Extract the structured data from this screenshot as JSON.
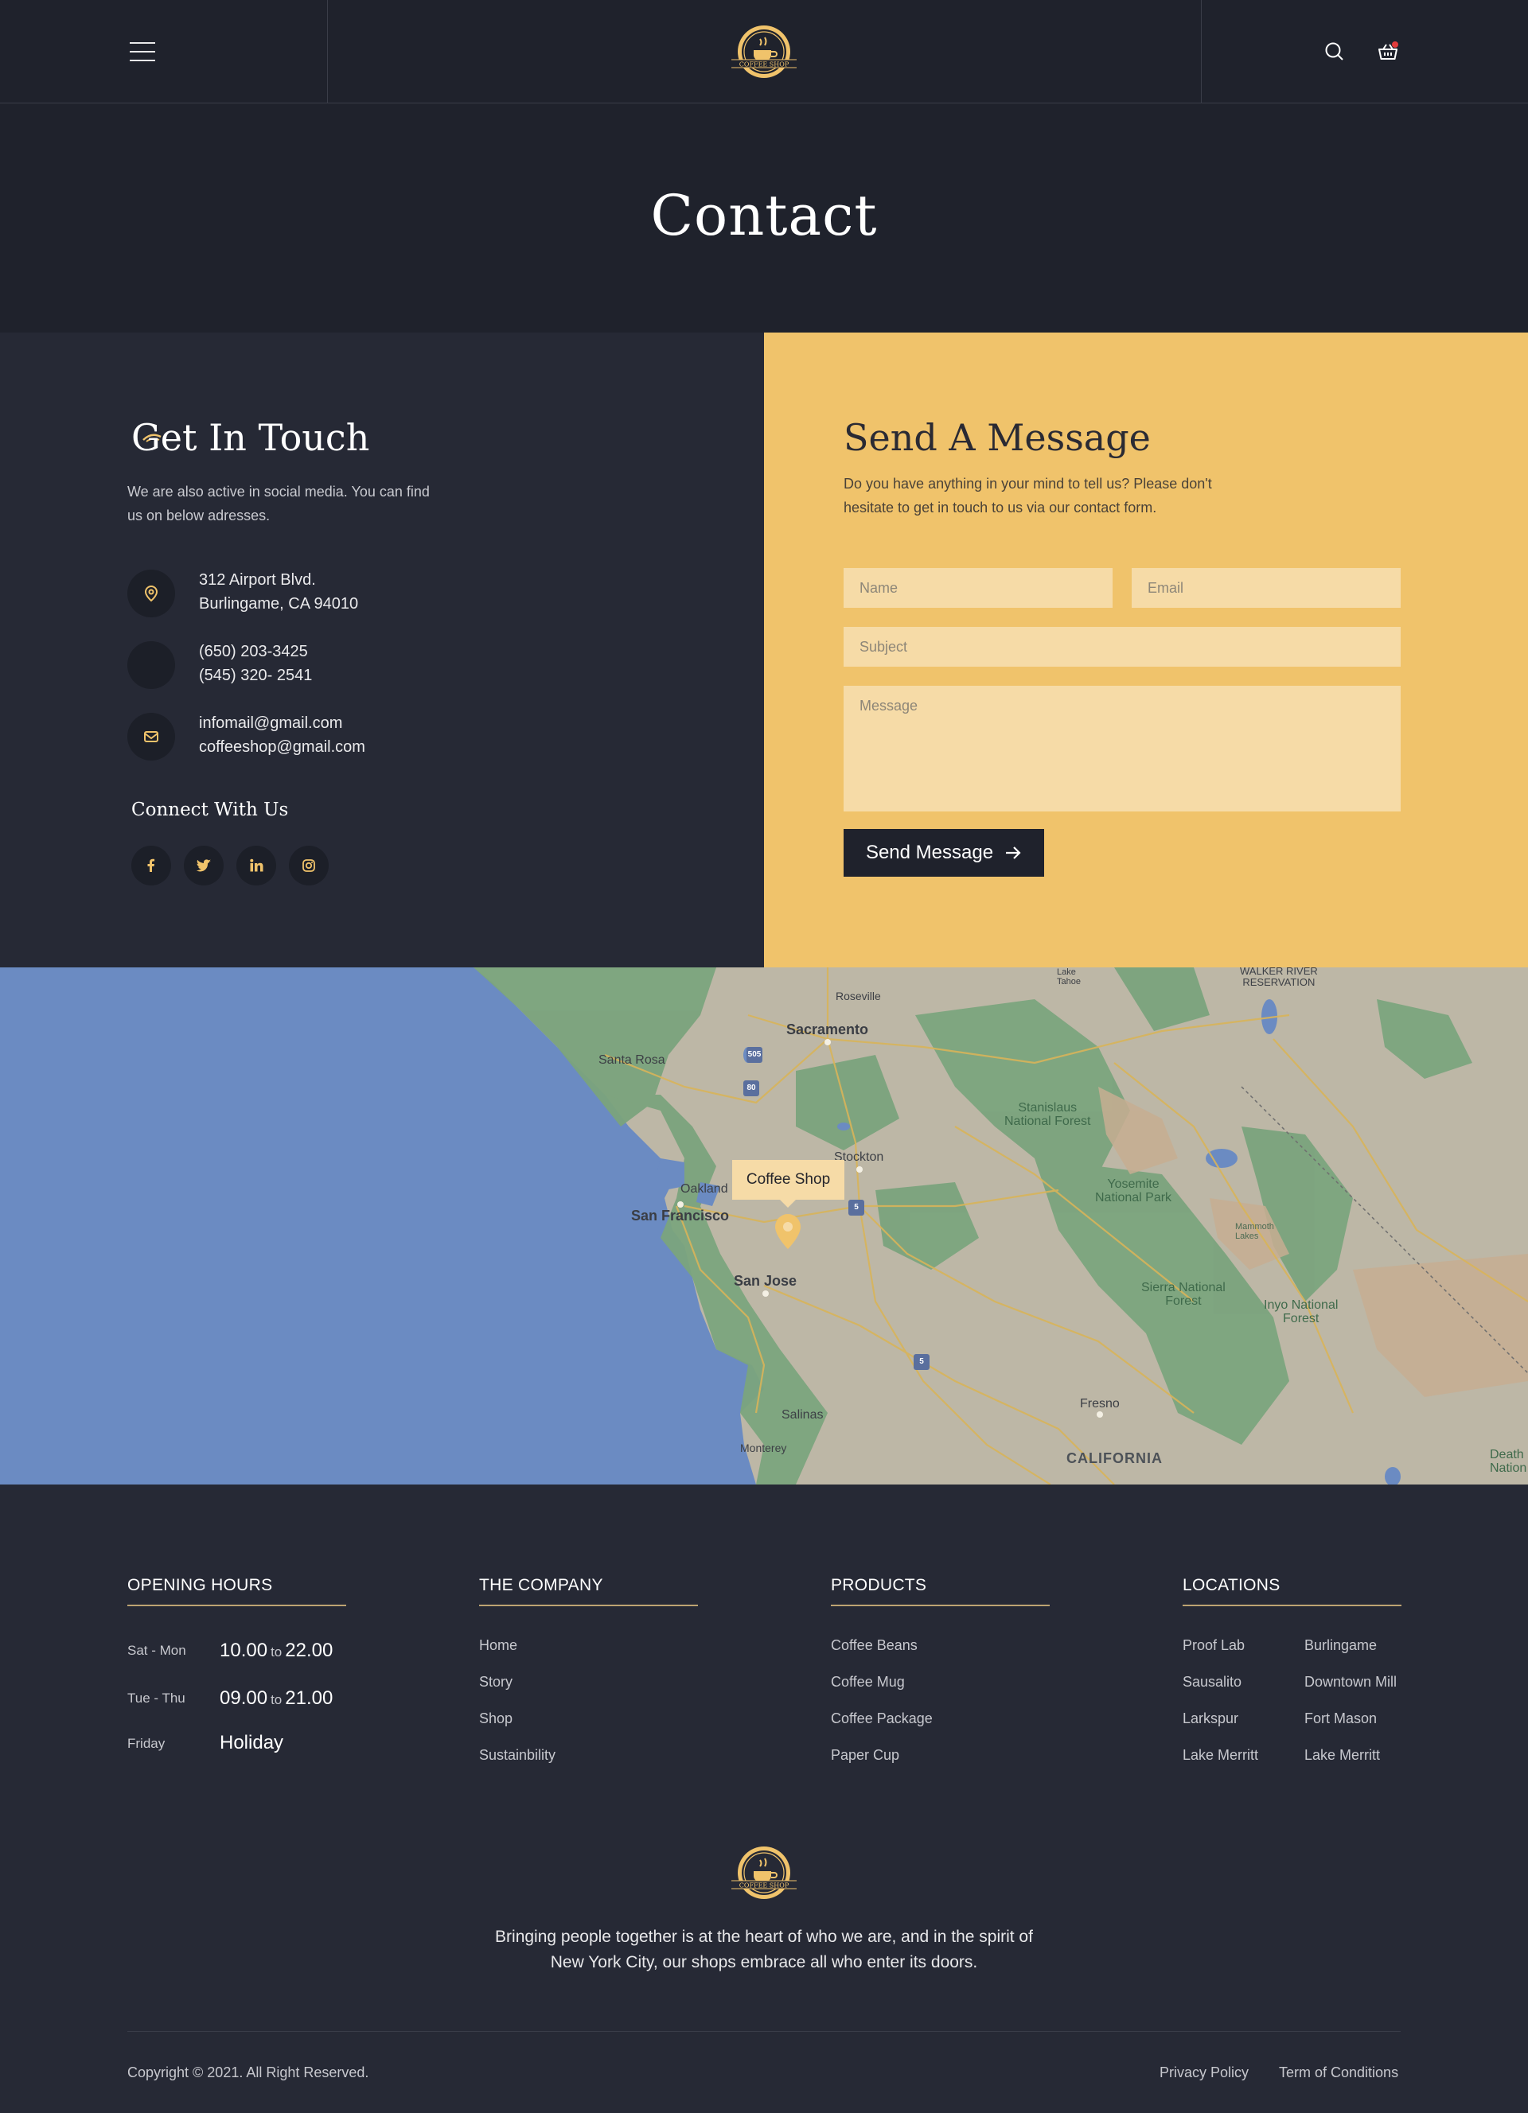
{
  "header": {
    "logo_text": "COFFEE SHOP",
    "menu_icon": "hamburger-menu-icon",
    "search_icon": "search-icon",
    "cart_icon": "basket-icon"
  },
  "hero": {
    "title": "Contact"
  },
  "get_in_touch": {
    "title": "Get In Touch",
    "text": "We are also active in social media. You can find us on below adresses.",
    "address_line1": "312 Airport Blvd.",
    "address_line2": "Burlingame, CA 94010",
    "phone1": "(650) 203-3425",
    "phone2": "(545) 320- 2541",
    "email1": "infomail@gmail.com",
    "email2": "coffeeshop@gmail.com",
    "connect_title": "Connect With Us",
    "social": [
      "facebook-icon",
      "twitter-icon",
      "linkedin-icon",
      "instagram-icon"
    ]
  },
  "send_message": {
    "title": "Send A Message",
    "text": "Do you have anything in your mind to tell us? Please don't hesitate to get in touch to us via our contact form.",
    "name_placeholder": "Name",
    "email_placeholder": "Email",
    "subject_placeholder": "Subject",
    "message_placeholder": "Message",
    "button_label": "Send Message"
  },
  "map": {
    "marker_label": "Coffee Shop",
    "labels": {
      "sacramento": "Sacramento",
      "roseville": "Roseville",
      "santa_rosa": "Santa Rosa",
      "stockton": "Stockton",
      "oakland": "Oakland",
      "san_francisco": "San Francisco",
      "san_jose": "San Jose",
      "salinas": "Salinas",
      "monterey": "Monterey",
      "fresno": "Fresno",
      "california": "CALIFORNIA",
      "stanislaus": "Stanislaus\nNational Forest",
      "yosemite": "Yosemite\nNational Park",
      "sierra": "Sierra National\nForest",
      "inyo": "Inyo National\nForest",
      "walker": "WALKER RIVER\nRESERVATION",
      "death": "Death\nNation",
      "mammoth": "Mammoth\nLakes",
      "tahoe": "Lake\nTahoe"
    },
    "shields": {
      "i505": "505",
      "i80": "80",
      "i5a": "5",
      "i5b": "5"
    }
  },
  "footer": {
    "hours_title": "OPENING HOURS",
    "hours": [
      {
        "day": "Sat - Mon",
        "open": "10.00",
        "sep": "to",
        "close": "22.00"
      },
      {
        "day": "Tue - Thu",
        "open": "09.00",
        "sep": "to",
        "close": "21.00"
      },
      {
        "day": "Friday",
        "text": "Holiday"
      }
    ],
    "company_title": "THE COMPANY",
    "company_links": [
      "Home",
      "Story",
      "Shop",
      "Sustainbility"
    ],
    "products_title": "PRODUCTS",
    "product_links": [
      "Coffee Beans",
      "Coffee Mug",
      "Coffee Package",
      "Paper Cup"
    ],
    "locations_title": "LOCATIONS",
    "locations_col1": [
      "Proof Lab",
      "Sausalito",
      "Larkspur",
      "Lake Merritt"
    ],
    "locations_col2": [
      "Burlingame",
      "Downtown Mill",
      "Fort Mason",
      "Lake Merritt"
    ],
    "description": "Bringing people together is at the heart of who we are, and in the spirit of New York City, our shops embrace all who enter its doors.",
    "copyright": "Copyright © 2021. All Right Reserved.",
    "privacy": "Privacy Policy",
    "terms": "Term of Conditions"
  },
  "colors": {
    "accent": "#f0c36b",
    "dark": "#1f222c",
    "panel": "#262935"
  }
}
